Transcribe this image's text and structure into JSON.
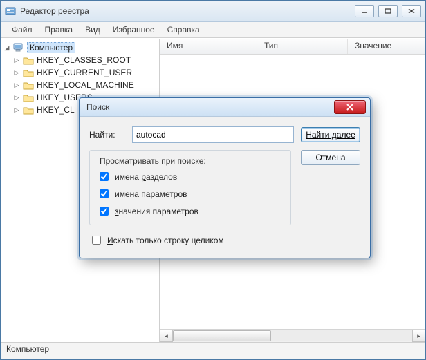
{
  "window": {
    "title": "Редактор реестра"
  },
  "menu": {
    "file": "Файл",
    "edit": "Правка",
    "view": "Вид",
    "favorites": "Избранное",
    "help": "Справка"
  },
  "tree": {
    "root": "Компьютер",
    "nodes": [
      "HKEY_CLASSES_ROOT",
      "HKEY_CURRENT_USER",
      "HKEY_LOCAL_MACHINE",
      "HKEY_USERS",
      "HKEY_CL"
    ]
  },
  "list": {
    "col_name": "Имя",
    "col_type": "Тип",
    "col_value": "Значение"
  },
  "statusbar": {
    "path": "Компьютер"
  },
  "dialog": {
    "title": "Поиск",
    "find_label": "Найти:",
    "find_value": "autocad",
    "find_next": "Найти далее",
    "cancel": "Отмена",
    "group_title": "Просматривать при поиске:",
    "chk_keys": "имена разделов",
    "chk_values": "имена параметров",
    "chk_data": "значения параметров",
    "chk_whole": "Искать только строку целиком",
    "keys_checked": true,
    "values_checked": true,
    "data_checked": true,
    "whole_checked": false
  }
}
